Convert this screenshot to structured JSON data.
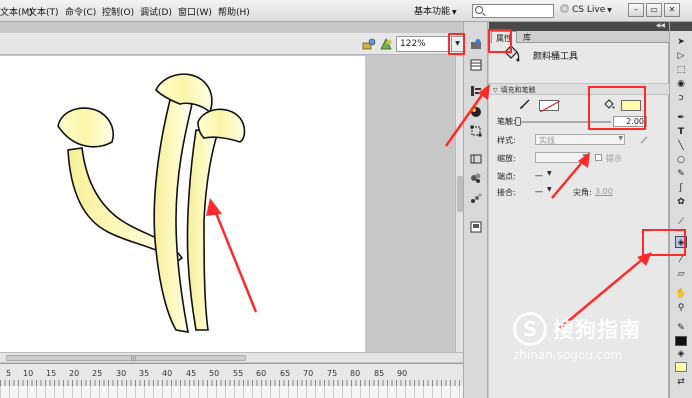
{
  "menubar": {
    "items": [
      "文本(M)",
      "文本(T)",
      "命令(C)",
      "控制(O)",
      "调试(D)",
      "窗口(W)",
      "帮助(H)"
    ],
    "workspace": "基本功能",
    "cslive": "CS Live"
  },
  "stage_toolbar": {
    "zoom": "122%"
  },
  "timeline": {
    "ruler_labels": [
      "5",
      "10",
      "15",
      "20",
      "25",
      "30",
      "35",
      "40",
      "45",
      "50",
      "55",
      "60",
      "65",
      "70",
      "75",
      "80",
      "85",
      "90"
    ]
  },
  "properties": {
    "tabs": [
      "属性",
      "库"
    ],
    "tool_name": "颜料桶工具",
    "section_title": "填充和笔触",
    "stroke_size_label": "笔触:",
    "stroke_size_value": "2.00",
    "style_label": "样式:",
    "style_value": "实线",
    "scale_label": "缩放:",
    "hint_label": "提示",
    "cap_label": "端点:",
    "cap_value": "一",
    "join_label": "接合:",
    "join_value": "一",
    "miter_label": "尖角:",
    "miter_value": "3.00"
  },
  "watermark": {
    "brand": "搜狗指南",
    "url": "zhinan.sogou.com",
    "logo_letter": "S"
  },
  "colors": {
    "fill": "#ffffa8",
    "stroke": "#111111",
    "highlight": "#ff2a2a"
  }
}
